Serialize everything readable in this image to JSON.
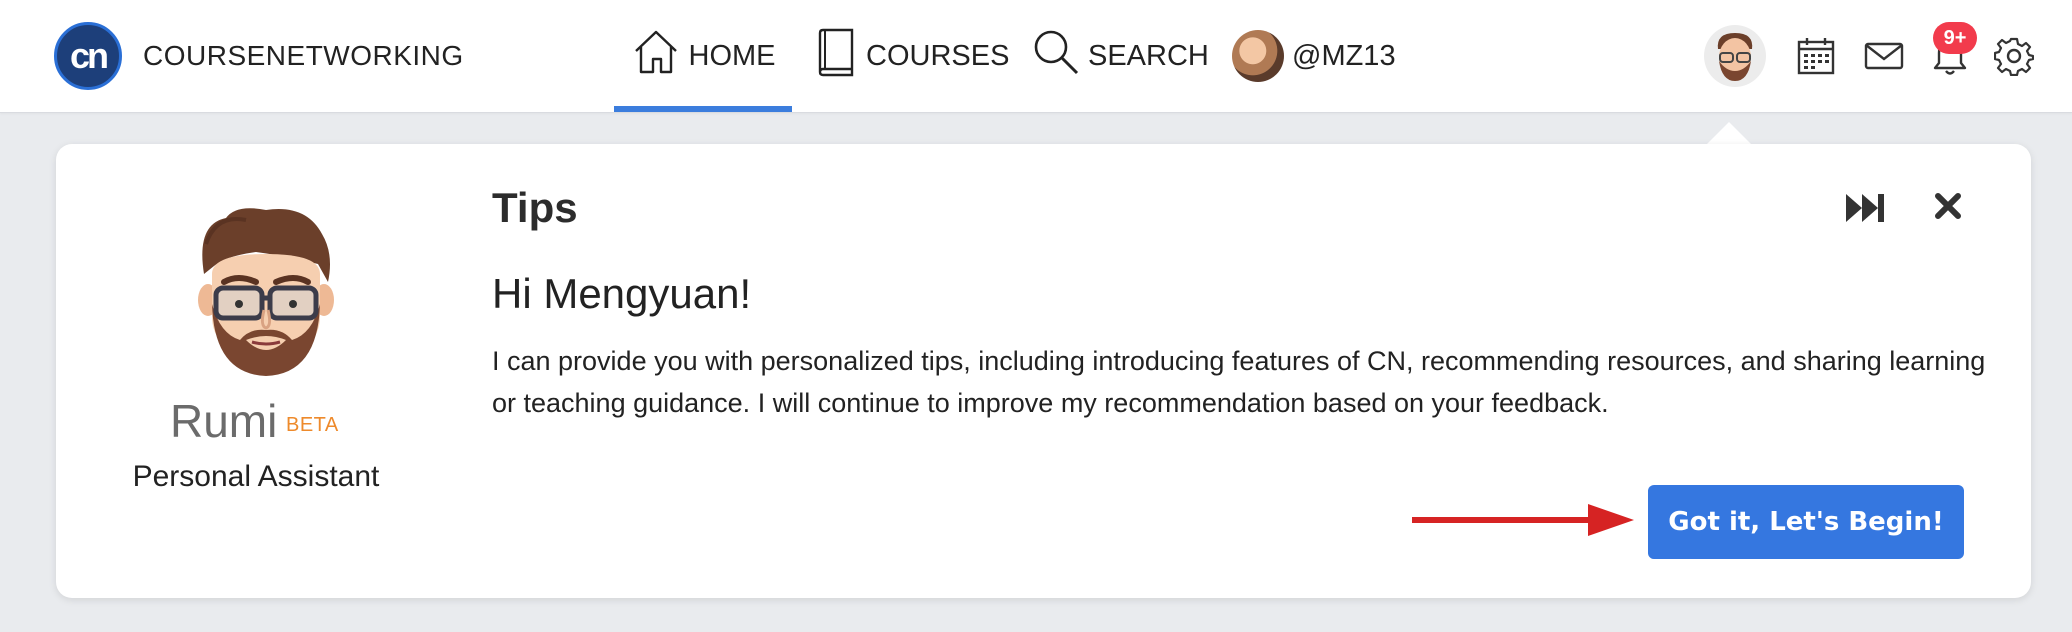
{
  "brand": {
    "logo_text": "cn",
    "name": "COURSENETWORKING"
  },
  "nav": {
    "items": [
      {
        "label": "HOME",
        "icon": "home-icon",
        "active": true
      },
      {
        "label": "COURSES",
        "icon": "book-icon",
        "active": false
      },
      {
        "label": "SEARCH",
        "icon": "search-icon",
        "active": false
      },
      {
        "label": "@MZ13",
        "icon": "user-avatar",
        "active": false
      }
    ]
  },
  "header_icons": {
    "items": [
      "assistant-avatar",
      "calendar-icon",
      "mail-icon",
      "bell-icon",
      "gear-icon"
    ],
    "notification_badge": "9+"
  },
  "tips_card": {
    "title": "Tips",
    "greeting": "Hi Mengyuan!",
    "message": "I can provide you with personalized tips, including introducing features of CN, recommending resources, and sharing learning or teaching guidance. I will continue to improve my recommendation based on your feedback.",
    "assistant": {
      "name": "Rumi",
      "tag": "BETA",
      "role": "Personal Assistant"
    },
    "cta_label": "Got it, Let's Begin!"
  },
  "colors": {
    "accent": "#3577e0",
    "nav_underline": "#3b7ddd",
    "badge": "#f23b4c",
    "beta": "#ee8a2b",
    "annotation_arrow": "#d62323",
    "page_bg": "#e9ebee"
  }
}
